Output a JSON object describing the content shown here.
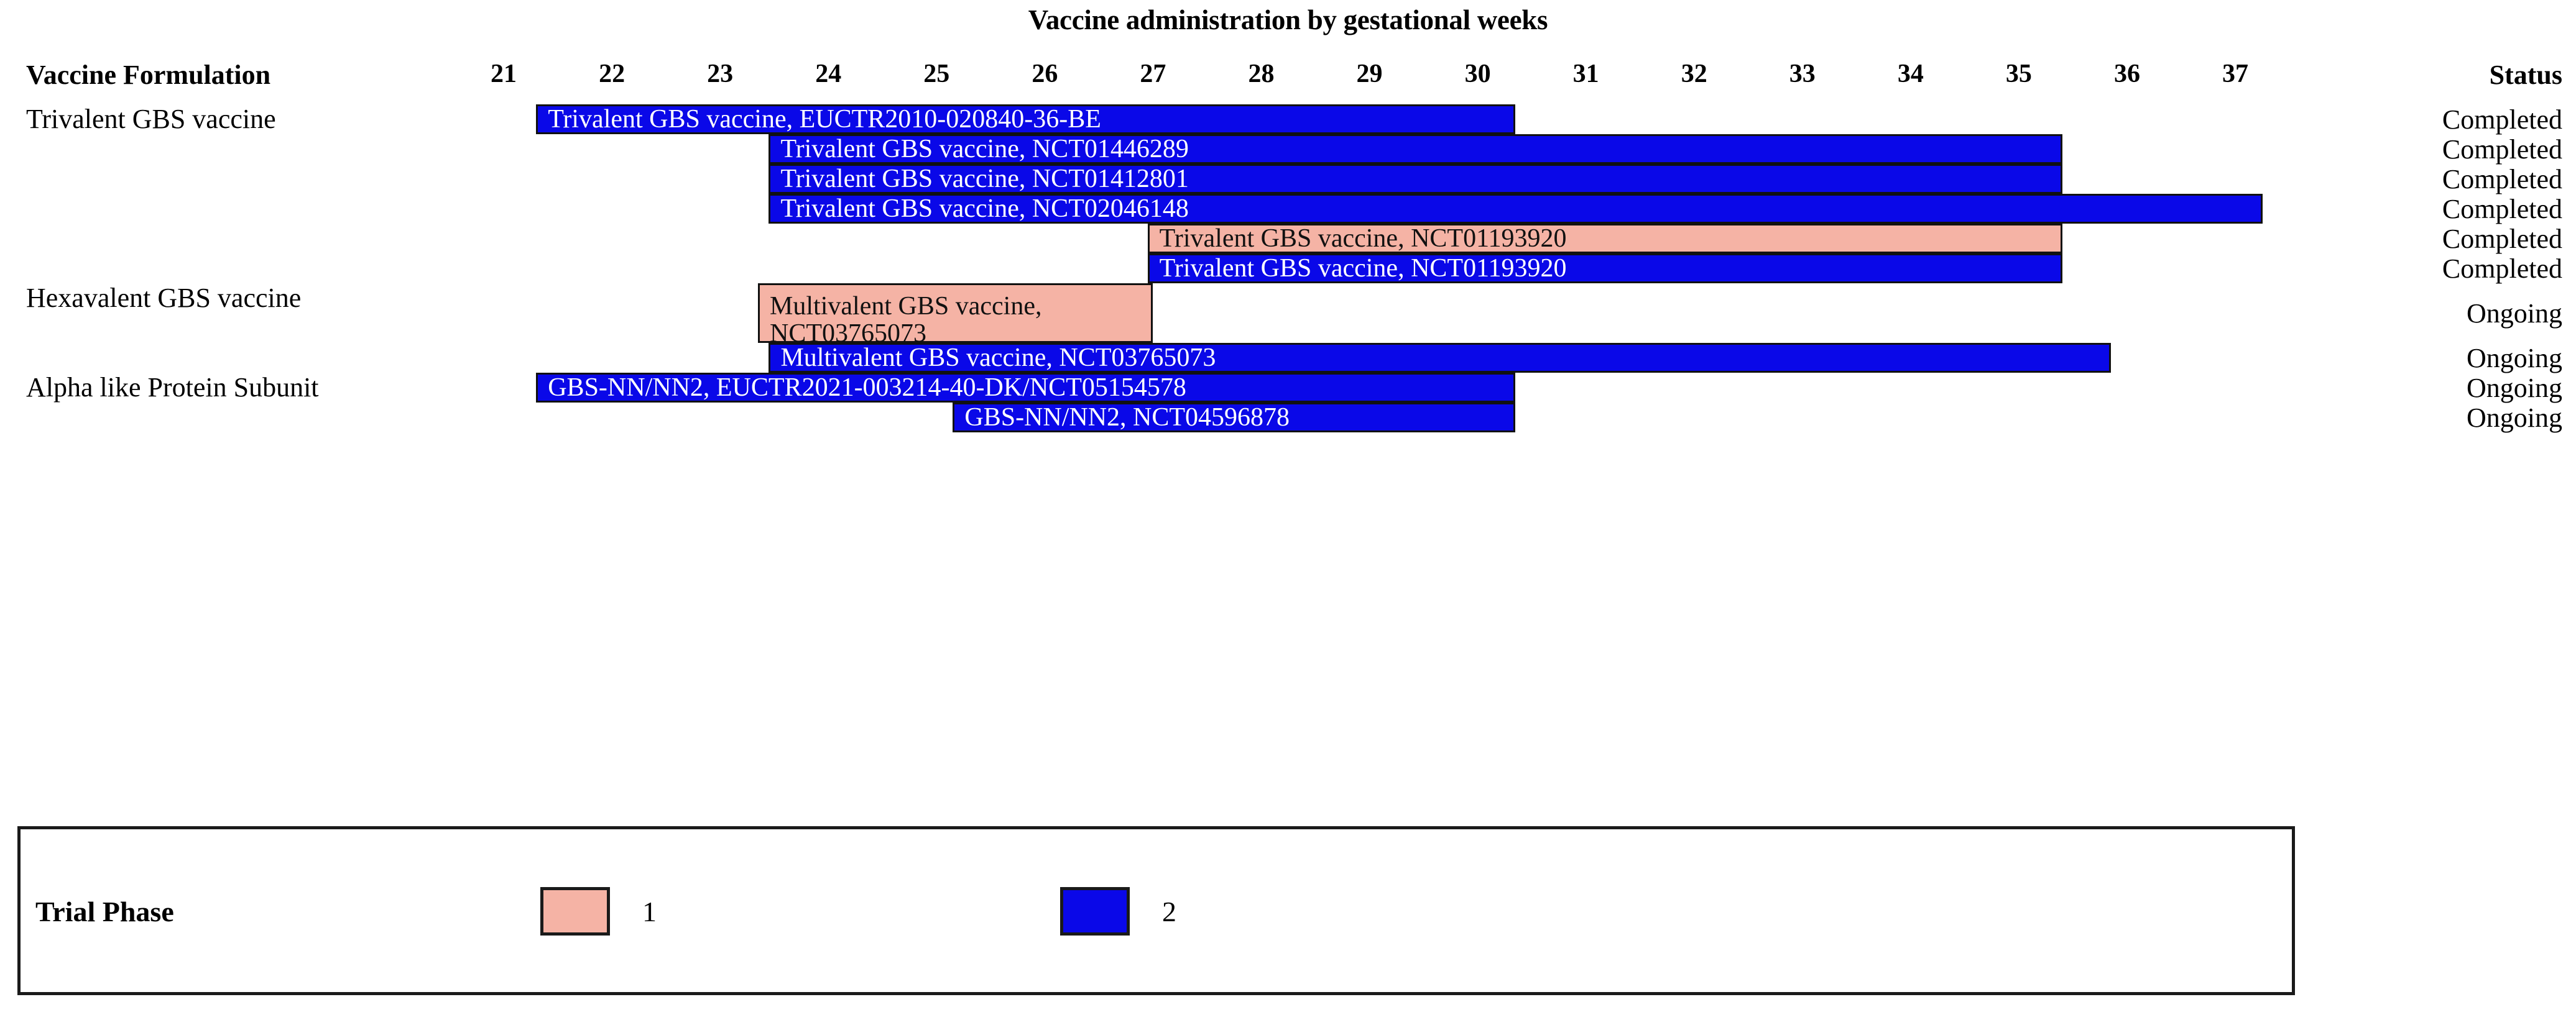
{
  "chart_data": {
    "type": "bar",
    "subtype": "gantt-timeline",
    "title": "Vaccine administration by gestational weeks",
    "xlabel": "",
    "ylabel": "",
    "xlim": [
      21,
      37
    ],
    "x_ticks": [
      "21",
      "22",
      "23",
      "24",
      "25",
      "26",
      "27",
      "28",
      "29",
      "30",
      "31",
      "32",
      "33",
      "34",
      "35",
      "36",
      "37"
    ],
    "grid": false,
    "legend_position": "bottom",
    "column_headers": {
      "left": "Vaccine Formulation",
      "right": "Status"
    },
    "group_labels": [
      {
        "label": "Trivalent GBS vaccine",
        "row": 0
      },
      {
        "label": "Hexavalent GBS vaccine",
        "row": 6
      },
      {
        "label": "Alpha like Protein Subunit",
        "row": 8
      }
    ],
    "bars": [
      {
        "label": "Trivalent GBS vaccine, EUCTR2010-020840-36-BE",
        "start": 21.3,
        "end": 30.35,
        "phase": 2,
        "status": "Completed",
        "lines": 1
      },
      {
        "label": "Trivalent GBS vaccine, NCT01446289",
        "start": 23.45,
        "end": 35.4,
        "phase": 2,
        "status": "Completed",
        "lines": 1
      },
      {
        "label": "Trivalent GBS vaccine, NCT01412801",
        "start": 23.45,
        "end": 35.4,
        "phase": 2,
        "status": "Completed",
        "lines": 1
      },
      {
        "label": "Trivalent GBS vaccine, NCT02046148",
        "start": 23.45,
        "end": 37.25,
        "phase": 2,
        "status": "Completed",
        "lines": 1
      },
      {
        "label": "Trivalent GBS vaccine, NCT01193920",
        "start": 26.95,
        "end": 35.4,
        "phase": 1,
        "status": "Completed",
        "lines": 1
      },
      {
        "label": "Trivalent GBS vaccine, NCT01193920",
        "start": 26.95,
        "end": 35.4,
        "phase": 2,
        "status": "Completed",
        "lines": 1
      },
      {
        "label": "Multivalent GBS vaccine,\nNCT03765073",
        "start": 23.35,
        "end": 27.0,
        "phase": 1,
        "status": "Ongoing",
        "lines": 2
      },
      {
        "label": "Multivalent GBS vaccine, NCT03765073",
        "start": 23.45,
        "end": 35.85,
        "phase": 2,
        "status": "Ongoing",
        "lines": 1
      },
      {
        "label": "GBS-NN/NN2, EUCTR2021-003214-40-DK/NCT05154578",
        "start": 21.3,
        "end": 30.35,
        "phase": 2,
        "status": "Ongoing",
        "lines": 1
      },
      {
        "label": "GBS-NN/NN2, NCT04596878",
        "start": 25.15,
        "end": 30.35,
        "phase": 2,
        "status": "Ongoing",
        "lines": 1
      }
    ],
    "legend": {
      "title": "Trial Phase",
      "entries": [
        {
          "label": "1",
          "phase": 1,
          "color": "#f5b3a5"
        },
        {
          "label": "2",
          "phase": 2,
          "color": "#0a08e8"
        }
      ]
    },
    "colors": {
      "phase1": "#f5b3a5",
      "phase2": "#0a08e8",
      "bar_border": "#111111",
      "text": "#000000",
      "background": "#ffffff"
    }
  }
}
